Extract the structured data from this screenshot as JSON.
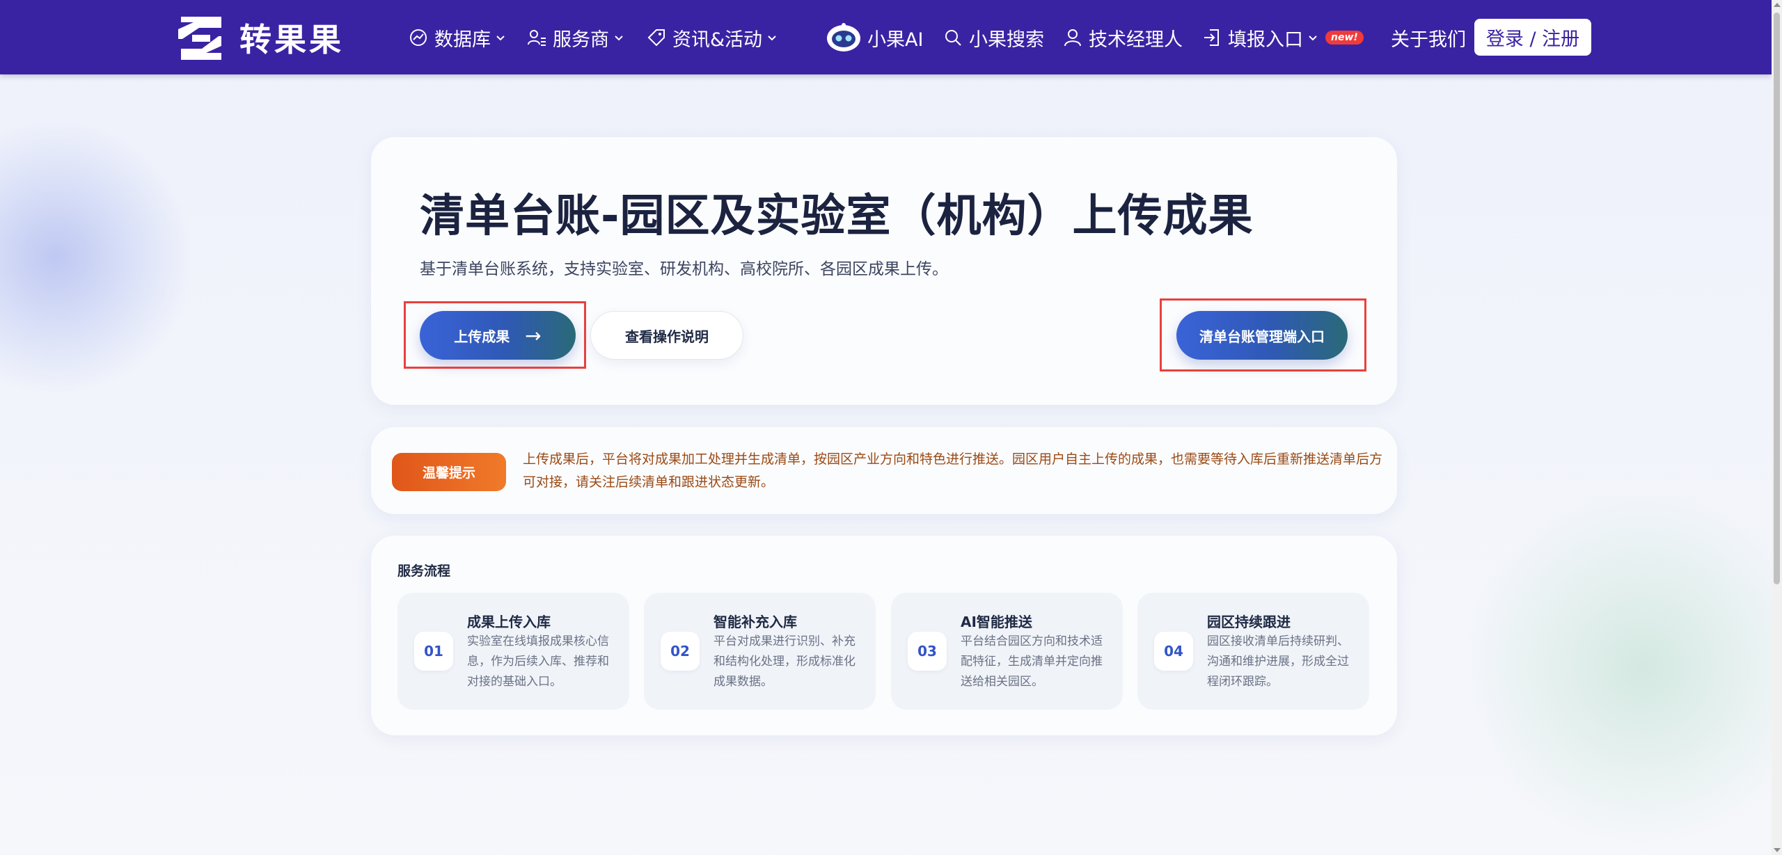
{
  "nav": {
    "brand": "转果果",
    "items": [
      {
        "label": "数据库",
        "icon": "chart-icon"
      },
      {
        "label": "服务商",
        "icon": "user-list-icon"
      },
      {
        "label": "资讯&活动",
        "icon": "tag-icon"
      },
      {
        "label": "小果AI",
        "icon": "robot-icon"
      },
      {
        "label": "小果搜索",
        "icon": "search-icon"
      },
      {
        "label": "技术经理人",
        "icon": "person-icon"
      },
      {
        "label": "填报入口",
        "icon": "login-icon",
        "badge": "new!"
      },
      {
        "label": "关于我们"
      }
    ],
    "login_label": "登录 / 注册"
  },
  "hero": {
    "title": "清单台账-园区及实验室（机构）上传成果",
    "subtitle": "基于清单台账系统，支持实验室、研发机构、高校院所、各园区成果上传。",
    "upload_label": "上传成果",
    "upload_arrow": "→",
    "guide_label": "查看操作说明",
    "admin_label": "清单台账管理端入口"
  },
  "notice": {
    "badge": "温馨提示",
    "text": "上传成果后，平台将对成果加工处理并生成清单，按园区产业方向和特色进行推送。园区用户自主上传的成果，也需要等待入库后重新推送清单后方可对接，请关注后续清单和跟进状态更新。"
  },
  "process": {
    "title": "服务流程",
    "steps": [
      {
        "num": "01",
        "title": "成果上传入库",
        "desc": "实验室在线填报成果核心信息，作为后续入库、推荐和对接的基础入口。"
      },
      {
        "num": "02",
        "title": "智能补充入库",
        "desc": "平台对成果进行识别、补充和结构化处理，形成标准化成果数据。"
      },
      {
        "num": "03",
        "title": "AI智能推送",
        "desc": "平台结合园区方向和技术适配特征，生成清单并定向推送给相关园区。"
      },
      {
        "num": "04",
        "title": "园区持续跟进",
        "desc": "园区接收清单后持续研判、沟通和维护进展，形成全过程闭环跟踪。"
      }
    ]
  },
  "colors": {
    "nav_bg": "#3a23a3",
    "primary_gradient": [
      "#3a63d8",
      "#2a6a78"
    ],
    "notice_badge": "#e0561a",
    "highlight": "#e8413d"
  }
}
